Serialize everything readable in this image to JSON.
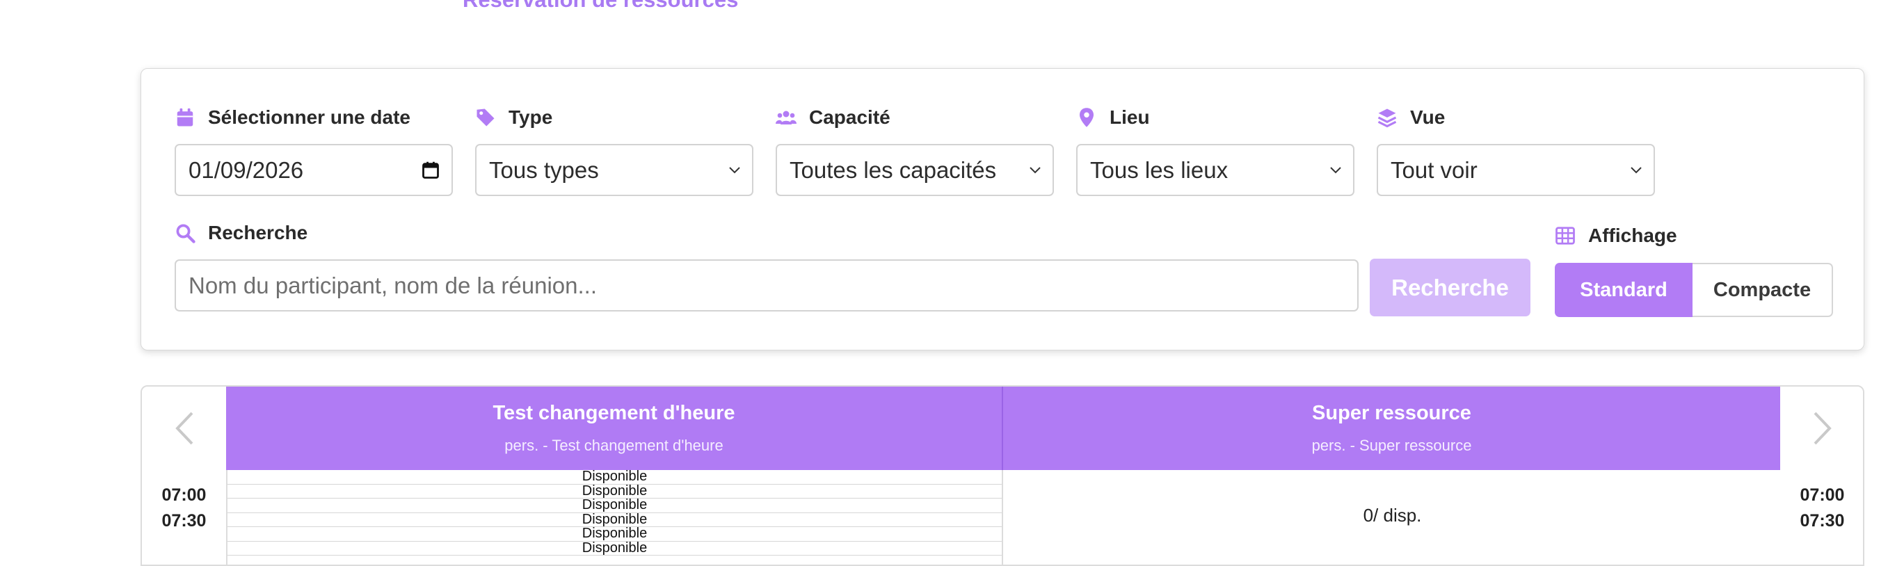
{
  "header": {
    "title": "Réservation de ressources"
  },
  "filters": {
    "date": {
      "label": "Sélectionner une date",
      "value": "01/09/2026"
    },
    "type": {
      "label": "Type",
      "value": "Tous types"
    },
    "capacity": {
      "label": "Capacité",
      "value": "Toutes les capacités"
    },
    "location": {
      "label": "Lieu",
      "value": "Tous les lieux"
    },
    "view": {
      "label": "Vue",
      "value": "Tout voir"
    },
    "search": {
      "label": "Recherche",
      "placeholder": "Nom du participant, nom de la réunion...",
      "button": "Recherche"
    },
    "display": {
      "label": "Affichage",
      "options": [
        "Standard",
        "Compacte"
      ],
      "selected": "Standard"
    }
  },
  "schedule": {
    "resources": [
      {
        "name": "Test changement d'heure",
        "subtitle": "pers. - Test changement d'heure"
      },
      {
        "name": "Super ressource",
        "subtitle": "pers. - Super ressource"
      }
    ],
    "times": [
      "07:00",
      "07:30"
    ],
    "slots": [
      "Disponible",
      "Disponible",
      "Disponible",
      "Disponible",
      "Disponible",
      "Disponible"
    ],
    "availability": "0/ disp."
  },
  "icons": {
    "date": "calendar-icon",
    "type": "tag-icon",
    "capacity": "users-icon",
    "location": "map-pin-icon",
    "view": "layers-icon",
    "search": "search-icon",
    "display": "grid-icon",
    "prev": "chevron-left-icon",
    "next": "chevron-right-icon"
  },
  "colors": {
    "accent": "#b07bf4",
    "accent_light": "#d4b9fa",
    "title": "#a87af2"
  }
}
